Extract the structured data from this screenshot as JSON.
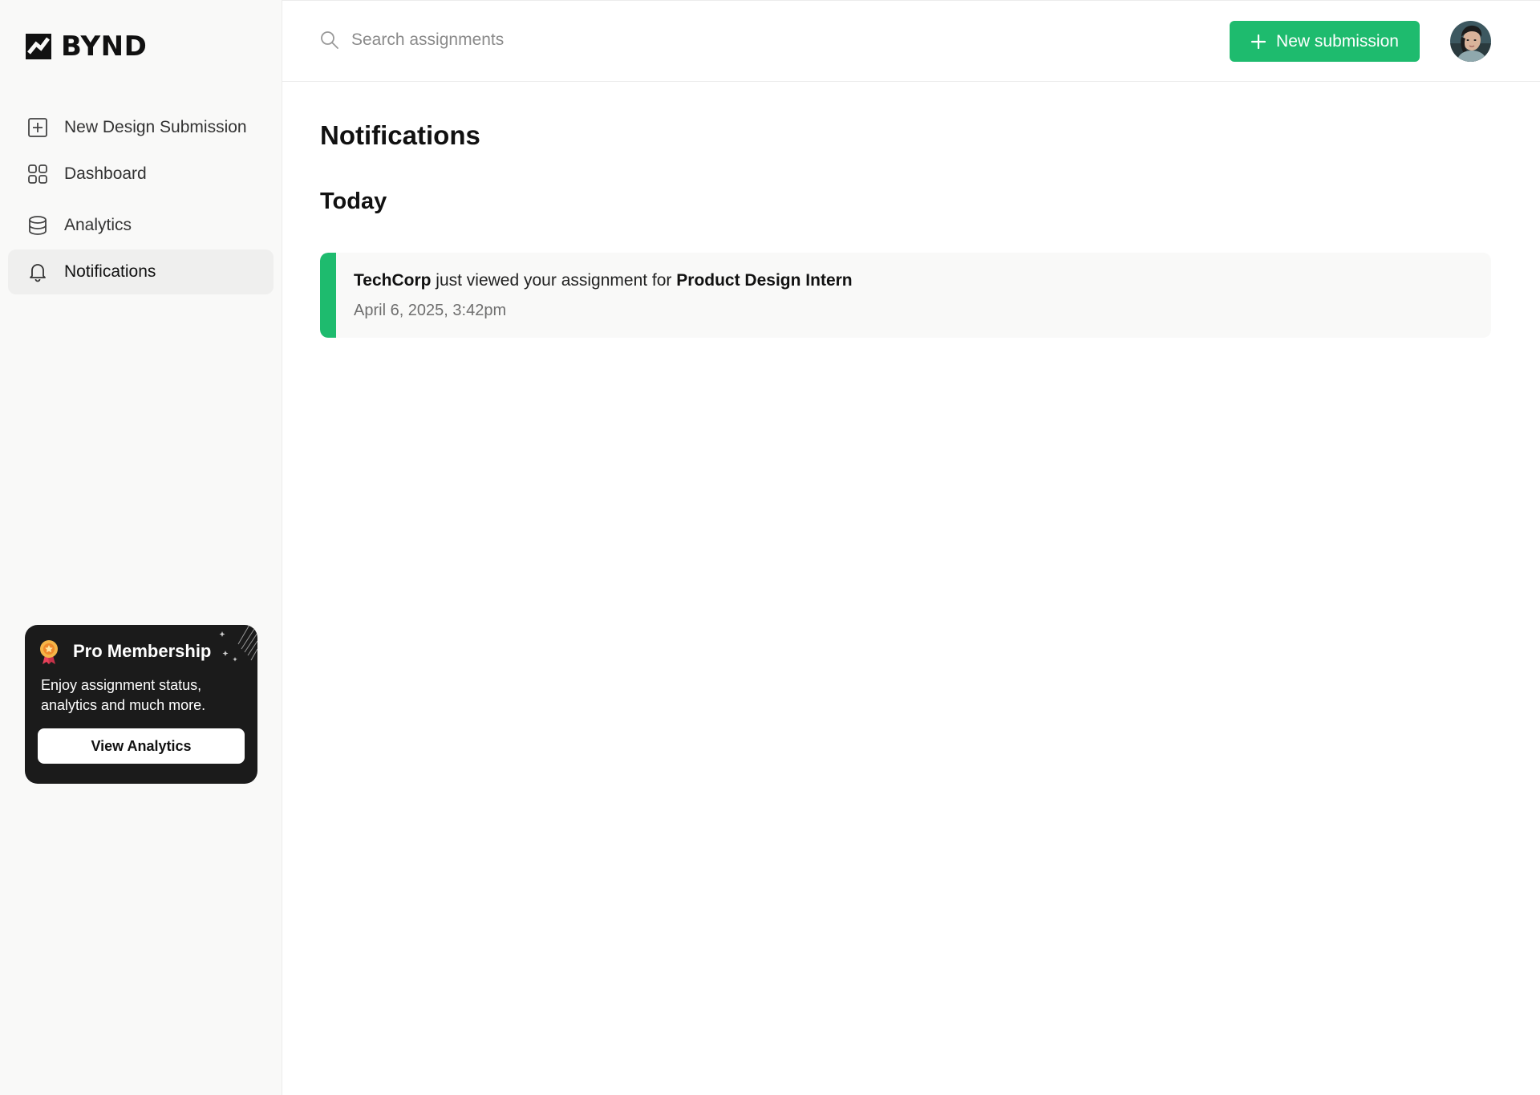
{
  "brand": {
    "name": "BYND"
  },
  "sidebar": {
    "items": [
      {
        "label": "New Design Submission",
        "icon": "plus-square-icon"
      },
      {
        "label": "Dashboard",
        "icon": "grid-icon"
      },
      {
        "label": "Analytics",
        "icon": "database-icon"
      },
      {
        "label": "Notifications",
        "icon": "bell-icon",
        "active": true
      }
    ]
  },
  "promo": {
    "title": "Pro Membership",
    "text": "Enjoy assignment status, analytics and much more.",
    "button": "View Analytics"
  },
  "header": {
    "search_placeholder": "Search assignments",
    "new_button": "New submission"
  },
  "main": {
    "title": "Notifications",
    "section": "Today",
    "notifications": [
      {
        "company": "TechCorp",
        "message": " just viewed your assignment for ",
        "role": "Product Design Intern",
        "time": "April 6, 2025, 3:42pm"
      }
    ]
  },
  "colors": {
    "accent": "#1ebb6e",
    "promo_bg": "#1b1b1b",
    "sidebar_bg": "#f9f9f8"
  }
}
